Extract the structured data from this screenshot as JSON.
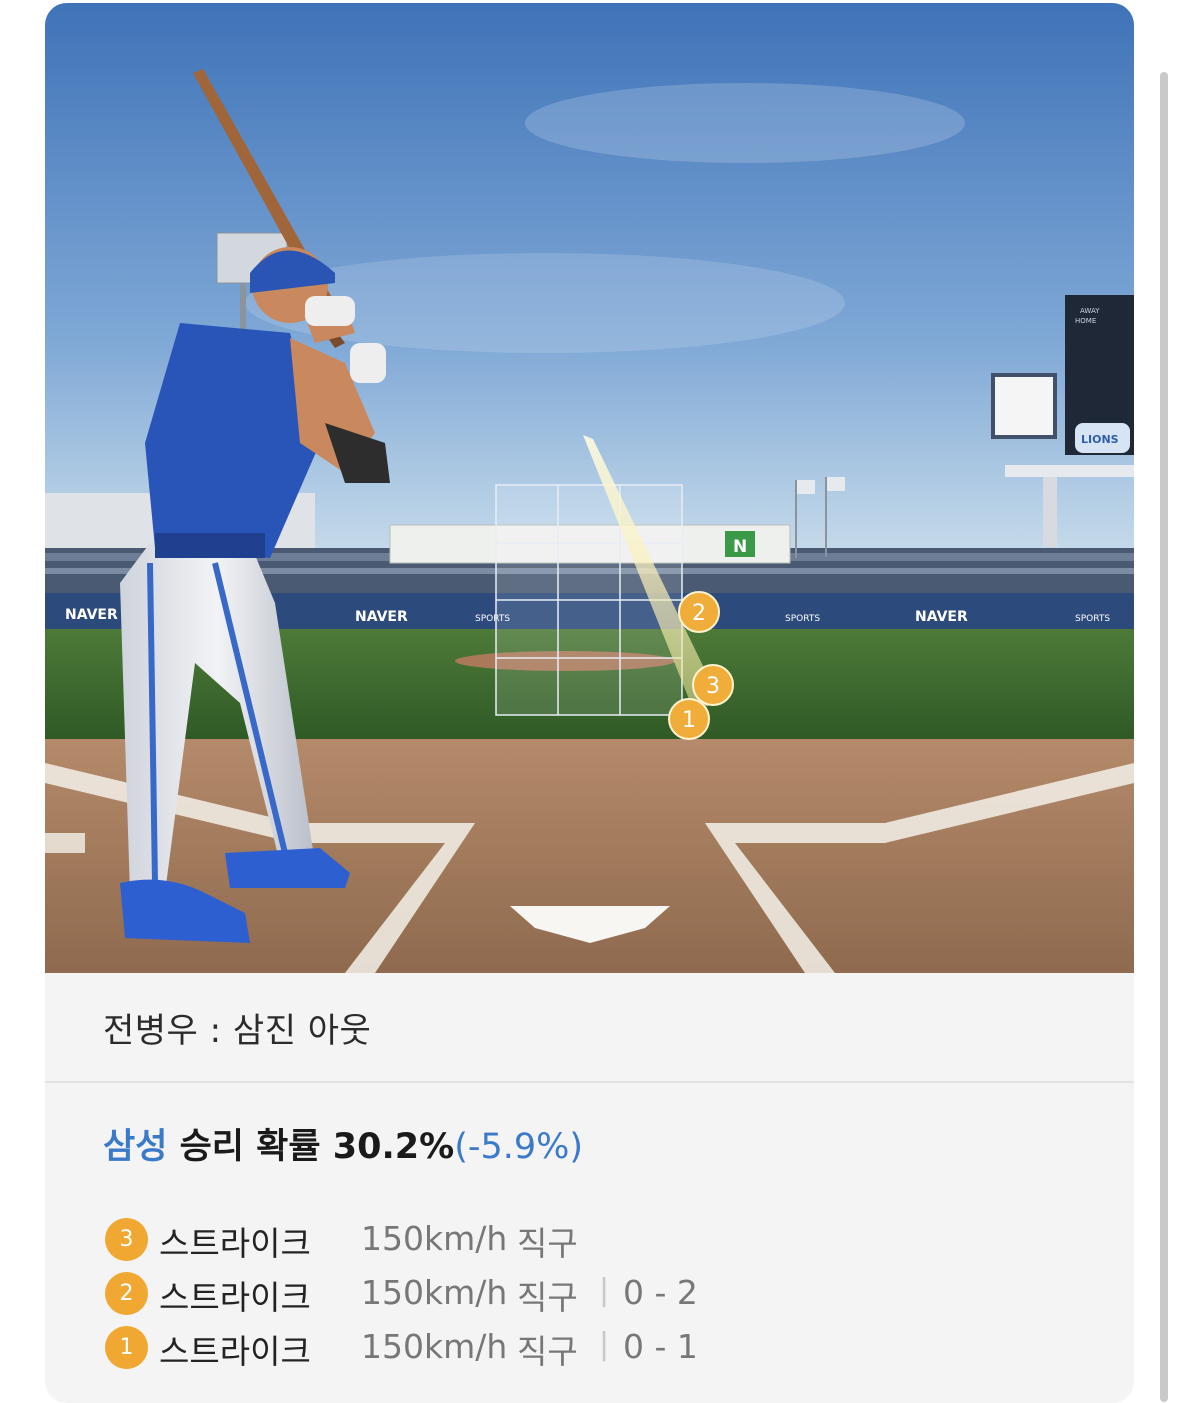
{
  "scene": {
    "ad_banner": {
      "left": "NAVER",
      "center": "NAVER",
      "right": "NAVER",
      "sports": [
        "SPORTS",
        "SPORTS",
        "SPORTS"
      ]
    },
    "board_n": "N",
    "scoreboard": {
      "away": "AWAY",
      "home": "HOME"
    },
    "lions_logo": "LIONS",
    "pitch_markers": [
      "2",
      "3",
      "1"
    ]
  },
  "result": {
    "text": "전병우 : 삼진 아웃"
  },
  "win_probability": {
    "team": "삼성",
    "label": " 승리 확률 30.2%",
    "delta": "(-5.9%)"
  },
  "pitches": [
    {
      "number": "3",
      "result": "스트라이크",
      "speed": "150km/h",
      "type": "직구",
      "count": ""
    },
    {
      "number": "2",
      "result": "스트라이크",
      "speed": "150km/h",
      "type": "직구",
      "count": "0 - 2"
    },
    {
      "number": "1",
      "result": "스트라이크",
      "speed": "150km/h",
      "type": "직구",
      "count": "0 - 1"
    }
  ],
  "colors": {
    "accent_blue": "#3a7ac9",
    "pitch_badge": "#f0a832"
  }
}
